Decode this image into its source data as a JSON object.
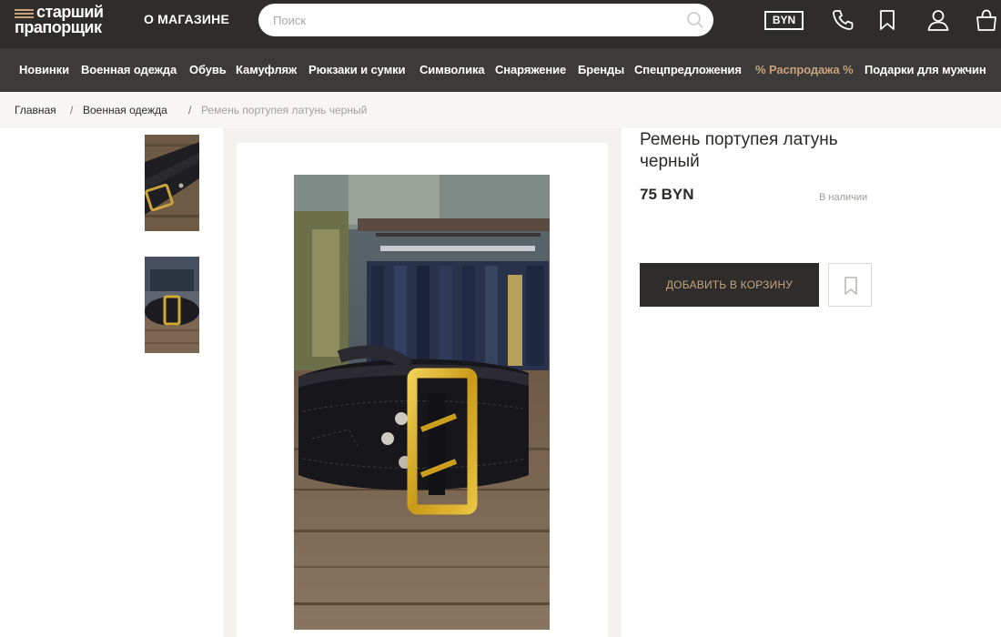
{
  "header": {
    "logo_line1": "старший",
    "logo_line2": "прапорщик",
    "about_label": "О МАГАЗИНЕ",
    "search_placeholder": "Поиск",
    "currency": "BYN",
    "icons": [
      "search-icon",
      "phone-icon",
      "bookmark-icon",
      "user-icon",
      "bag-icon"
    ]
  },
  "nav": {
    "items": [
      {
        "label": "Новинки"
      },
      {
        "label": "Военная одежда"
      },
      {
        "label": "Обувь"
      },
      {
        "label": "Камуфляж"
      },
      {
        "label": "Рюкзаки и сумки"
      },
      {
        "label": "Символика"
      },
      {
        "label": "Снаряжение"
      },
      {
        "label": "Бренды"
      },
      {
        "label": "Спецпредложения"
      },
      {
        "label": "% Распродажа %"
      },
      {
        "label": "Подарки для мужчин"
      }
    ]
  },
  "breadcrumb": {
    "items": [
      {
        "label": "Главная"
      },
      {
        "label": "Военная одежда"
      },
      {
        "label": "Ремень портупея латунь черный"
      }
    ],
    "separator": "/"
  },
  "product": {
    "title": "Ремень портупея латунь черный",
    "price": "75 BYN",
    "availability": "В наличии",
    "add_to_cart_label": "ДОБАВИТЬ В КОРЗИНУ"
  },
  "colors": {
    "header_bg": "#2e2d2b",
    "nav_bg": "#3c3b39",
    "accent": "#c9a27c",
    "breadcrumb_bg": "#f7f6f3"
  }
}
